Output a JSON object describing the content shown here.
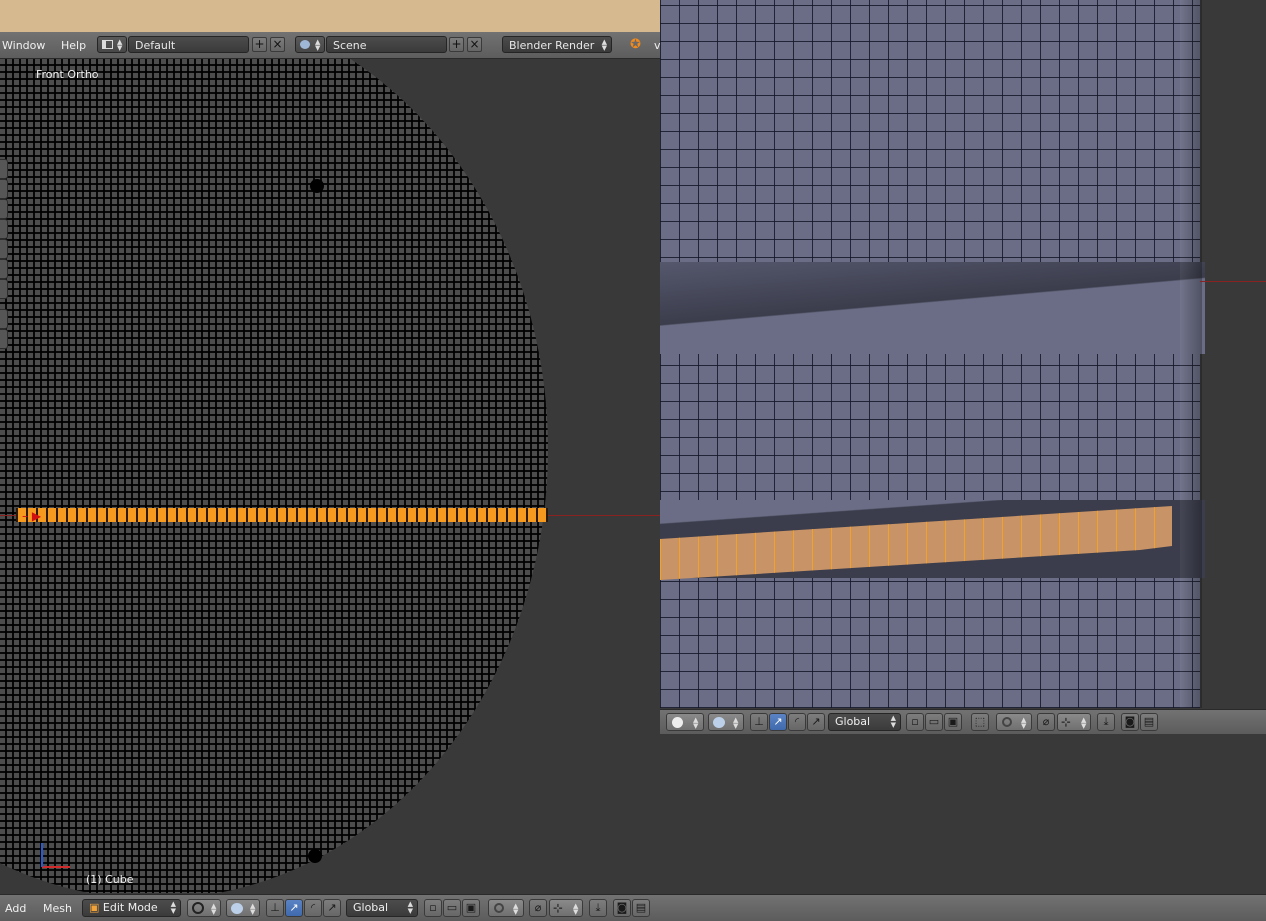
{
  "info_header": {
    "menus": [
      "Window",
      "Help"
    ],
    "screen_layout": "Default",
    "scene": "Scene",
    "render_engine": "Blender Render",
    "truncated_menu": "v"
  },
  "left_viewport": {
    "view_label": "Front Ortho",
    "object_label": "(1) Cube"
  },
  "left_header": {
    "menus": [
      "Add",
      "Mesh"
    ],
    "mode": "Edit Mode",
    "orientation": "Global"
  },
  "right_header": {
    "orientation": "Global"
  },
  "colors": {
    "selection": "#f59a1f",
    "mesh_face": "#6a6d85",
    "header": "#727272",
    "axis_x": "#8a2222"
  }
}
